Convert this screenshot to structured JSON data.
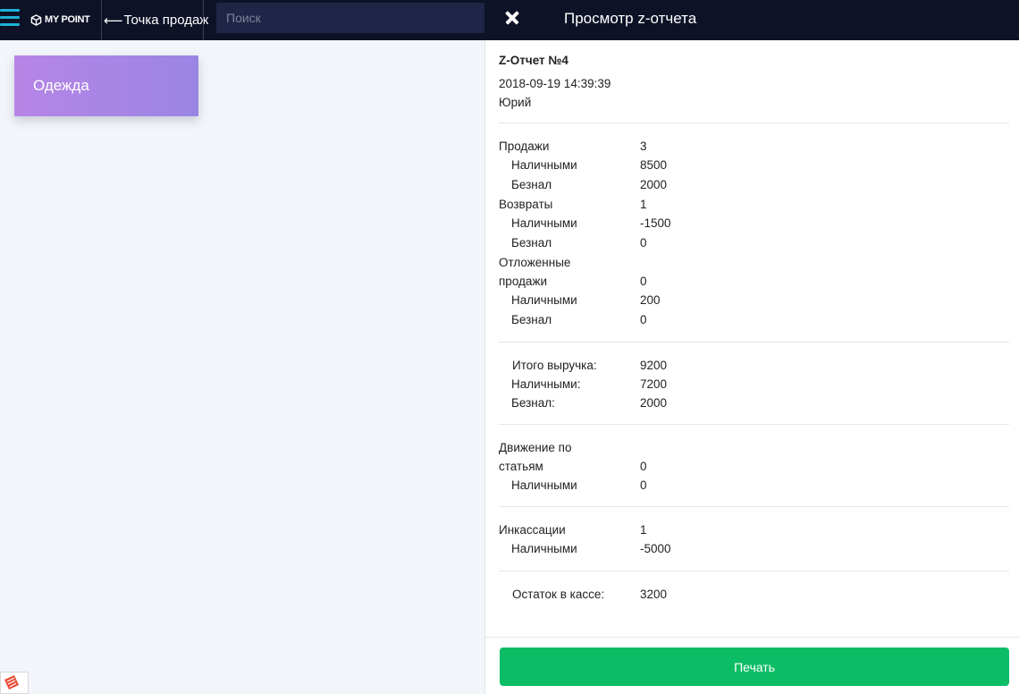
{
  "header": {
    "logo_text": "MY POINT",
    "back_label": "Точка продаж",
    "search_placeholder": "Поиск",
    "panel_title": "Просмотр z-отчета"
  },
  "categories": [
    {
      "label": "Одежда"
    }
  ],
  "report": {
    "title": "Z-Отчет №4",
    "date": "2018-09-19 14:39:39",
    "user": "Юрий",
    "sales": {
      "label": "Продажи",
      "value": "3",
      "cash_label": "Наличными",
      "cash": "8500",
      "card_label": "Безнал",
      "card": "2000"
    },
    "returns": {
      "label": "Возвраты",
      "value": "1",
      "cash_label": "Наличными",
      "cash": "-1500",
      "card_label": "Безнал",
      "card": "0"
    },
    "deferred": {
      "label_line1": "Отложенные",
      "label_line2": "продажи",
      "value": "0",
      "cash_label": "Наличными",
      "cash": "200",
      "card_label": "Безнал",
      "card": "0"
    },
    "totals": {
      "revenue_label": "Итого выручка:",
      "revenue": "9200",
      "cash_label": "Наличными:",
      "cash": "7200",
      "card_label": "Безнал:",
      "card": "2000"
    },
    "movements": {
      "label_line1": "Движение по",
      "label_line2": "статьям",
      "value": "0",
      "cash_label": "Наличными",
      "cash": "0"
    },
    "encashment": {
      "label": "Инкассации",
      "value": "1",
      "cash_label": "Наличными",
      "cash": "-5000"
    },
    "balance": {
      "label": "Остаток в кассе:",
      "value": "3200"
    }
  },
  "print_button_label": "Печать",
  "colors": {
    "topbar": "#0d1226",
    "accent": "#1db3d6",
    "print_button": "#0dbd66",
    "category_gradient_start": "#b685e6",
    "category_gradient_end": "#9a85e4"
  }
}
